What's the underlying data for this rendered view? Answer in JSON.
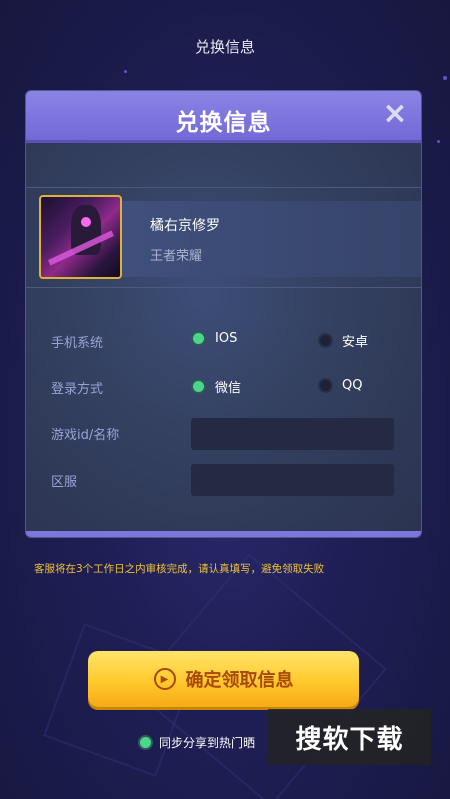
{
  "page": {
    "title": "兑换信息"
  },
  "modal": {
    "title": "兑换信息",
    "close_icon": "×",
    "game": {
      "name": "橘右京修罗",
      "category": "王者荣耀"
    },
    "form": {
      "system_label": "手机系统",
      "system_options": [
        {
          "label": "IOS",
          "selected": true
        },
        {
          "label": "安卓",
          "selected": false
        }
      ],
      "login_label": "登录方式",
      "login_options": [
        {
          "label": "微信",
          "selected": true
        },
        {
          "label": "QQ",
          "selected": false
        }
      ],
      "game_id_label": "游戏id/名称",
      "game_id_value": "",
      "server_label": "区服",
      "server_value": ""
    }
  },
  "notice": "客服将在3个工作日之内审核完成，请认真填写，避免领取失败",
  "cta": {
    "label": "确定领取信息",
    "icon": "play-circle-icon"
  },
  "share": {
    "label": "同步分享到热门晒"
  },
  "watermark": "搜软下载",
  "colors": {
    "accent": "#7269d6",
    "cta": "#ffc92d",
    "notice": "#f2c233",
    "radio_on": "#4bd68c"
  }
}
